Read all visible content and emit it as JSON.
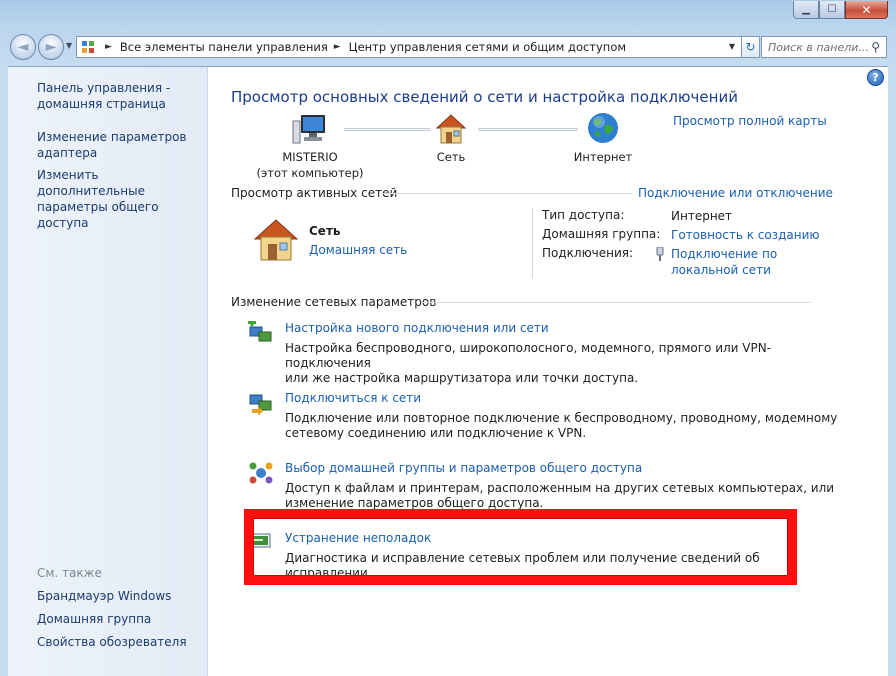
{
  "window": {
    "caption": {
      "minimize": "▁",
      "maximize": "☐",
      "close": "✕"
    }
  },
  "nav": {
    "back_glyph": "◄",
    "forward_glyph": "►",
    "breadcrumb": [
      "Все элементы панели управления",
      "Центр управления сетями и общим доступом"
    ],
    "breadcrumb_sep": "►",
    "search_placeholder": "Поиск в панели...",
    "refresh_glyph": "↻"
  },
  "sidebar": {
    "links": [
      [
        "Панель управления -",
        "домашняя страница"
      ],
      [
        "Изменение параметров",
        "адаптера"
      ],
      [
        "Изменить дополнительные",
        "параметры общего доступа"
      ]
    ],
    "see_also_header": "См. также",
    "see_also": [
      "Брандмауэр Windows",
      "Домашняя группа",
      "Свойства обозревателя"
    ]
  },
  "main": {
    "help_glyph": "?",
    "title": "Просмотр основных сведений о сети и настройка подключений",
    "full_map_link": "Просмотр полной карты",
    "map": {
      "computer": [
        "MISTERIO",
        "(этот компьютер)"
      ],
      "network": "Сеть",
      "internet": "Интернет"
    },
    "active": {
      "header": "Просмотр активных сетей",
      "connect_link": "Подключение или отключение",
      "network_name": "Сеть",
      "network_type": "Домашняя сеть",
      "access_type_label": "Тип доступа:",
      "access_type_value": "Интернет",
      "homegroup_label": "Домашняя группа:",
      "homegroup_value": "Готовность к созданию",
      "connections_label": "Подключения:",
      "connections_value": [
        "Подключение по",
        "локальной сети"
      ]
    },
    "change": {
      "header": "Изменение сетевых параметров",
      "tasks": [
        {
          "title": "Настройка нового подключения или сети",
          "desc": [
            "Настройка беспроводного, широкополосного, модемного, прямого или VPN-подключения",
            "или же настройка маршрутизатора или точки доступа."
          ]
        },
        {
          "title": "Подключиться к сети",
          "desc": [
            "Подключение или повторное подключение к беспроводному, проводному, модемному",
            "сетевому соединению или подключение к VPN."
          ]
        },
        {
          "title": "Выбор домашней группы и параметров общего доступа",
          "desc": [
            "Доступ к файлам и принтерам, расположенным на других сетевых компьютерах, или",
            "изменение параметров общего доступа."
          ]
        },
        {
          "title": "Устранение неполадок",
          "desc": [
            "Диагностика и исправление сетевых проблем или получение сведений об исправлении."
          ]
        }
      ]
    }
  },
  "colors": {
    "link": "#1a5fb4",
    "title": "#1a3d8c",
    "highlight": "#ff1010"
  }
}
